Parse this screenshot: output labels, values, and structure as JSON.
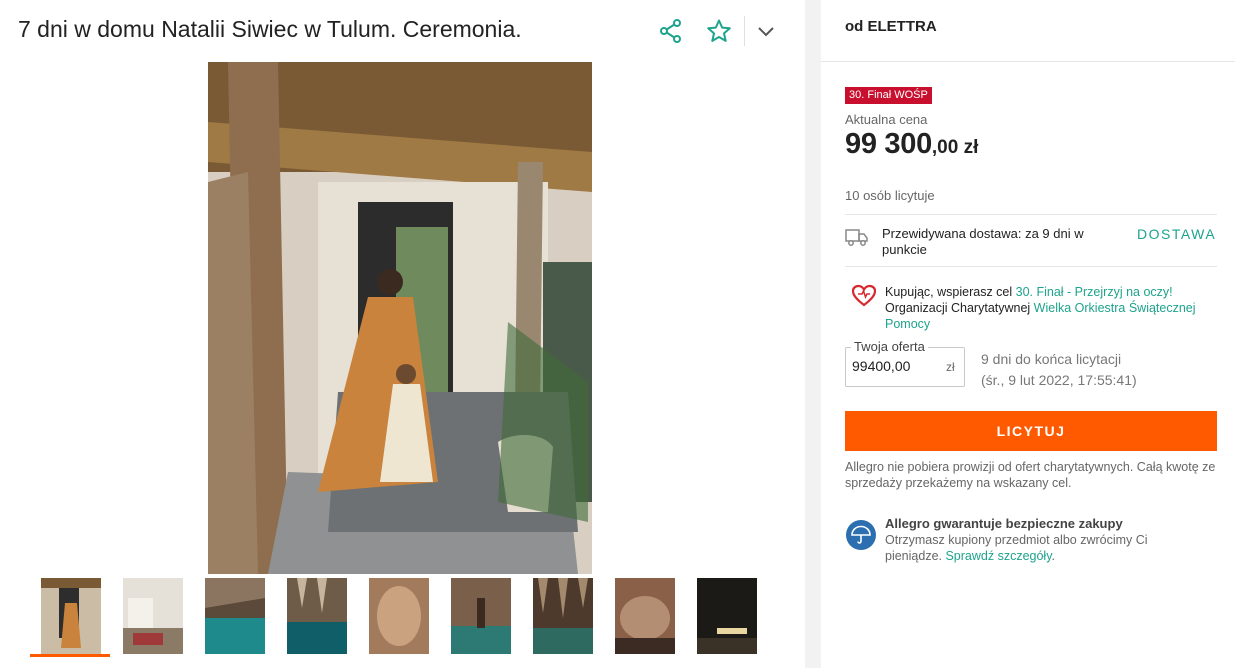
{
  "listing": {
    "title": "7 dni w domu Natalii Siwiec w Tulum. Ceremonia.",
    "share_icon": "share-icon",
    "favorite_icon": "star-icon",
    "expand_icon": "chevron-down-icon"
  },
  "gallery": {
    "thumbnails": [
      {
        "name": "thumb-1",
        "scene": "woman-and-girl"
      },
      {
        "name": "thumb-2",
        "scene": "living-room"
      },
      {
        "name": "thumb-3",
        "scene": "cenote-water"
      },
      {
        "name": "thumb-4",
        "scene": "cave-water"
      },
      {
        "name": "thumb-5",
        "scene": "cave-rock"
      },
      {
        "name": "thumb-6",
        "scene": "cave-woman"
      },
      {
        "name": "thumb-7",
        "scene": "cave-stalactites"
      },
      {
        "name": "thumb-8",
        "scene": "cave-interior"
      },
      {
        "name": "thumb-9",
        "scene": "night-path"
      }
    ],
    "active_index": 0
  },
  "seller": {
    "label": "od ELETTRA"
  },
  "badge": {
    "label": "30. Finał WOŚP",
    "color": "#c8102e"
  },
  "price": {
    "label": "Aktualna cena",
    "main": "99 300",
    "fraction": ",00 zł"
  },
  "bidders": {
    "text": "10 osób licytuje"
  },
  "delivery": {
    "icon": "truck-icon",
    "text": "Przewidywana dostawa: za 9 dni w punkcie",
    "link": "DOSTAWA"
  },
  "charity": {
    "icon": "heart-icon",
    "text_1": "Kupując, wspierasz cel ",
    "goal_link": "30. Finał - Przejrzyj na oczy!",
    "text_2": " Organizacji Charytatywnej ",
    "org_link": "Wielka Orkiestra Świątecznej Pomocy"
  },
  "offer": {
    "legend": "Twoja oferta",
    "value": "99400,00",
    "currency": "zł",
    "ends_line1": "9 dni do końca licytacji",
    "ends_line2": "(śr., 9 lut 2022, 17:55:41)"
  },
  "bid_button": {
    "label": "LICYTUJ",
    "color": "#ff5a00"
  },
  "note": {
    "text": "Allegro nie pobiera prowizji od ofert charytatywnych. Całą kwotę ze sprzedaży przekażemy na wskazany cel."
  },
  "guarantee": {
    "icon": "umbrella-icon",
    "title": "Allegro gwarantuje bezpieczne zakupy",
    "text": "Otrzymasz kupiony przedmiot albo zwrócimy Ci pieniądze. ",
    "link": "Sprawdź szczegóły",
    "period": "."
  },
  "colors": {
    "accent": "#1ea38c",
    "orange": "#ff5a00",
    "shield_blue": "#2b6fb0"
  }
}
